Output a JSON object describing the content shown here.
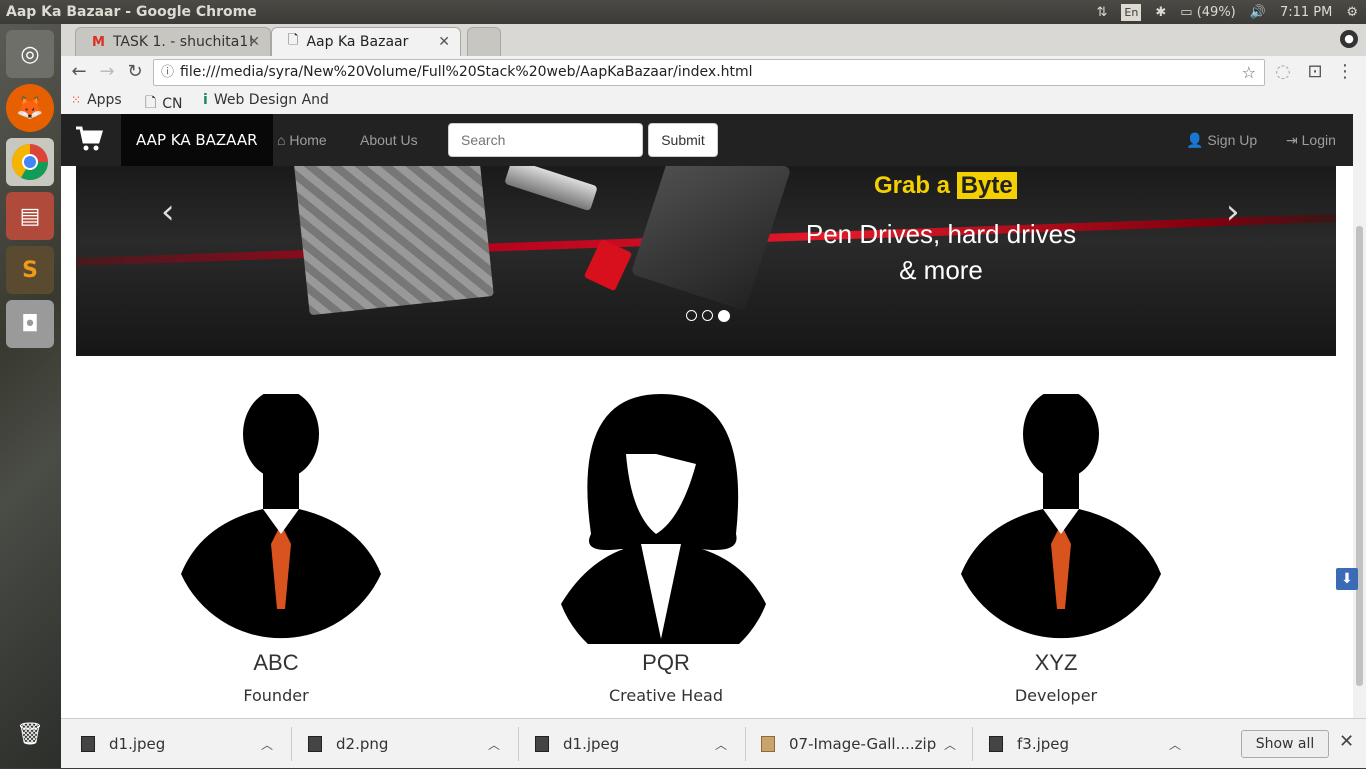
{
  "os": {
    "window_title": "Aap Ka Bazaar - Google Chrome",
    "keyboard": "En",
    "battery": "(49%)",
    "time": "7:11 PM"
  },
  "browser": {
    "tabs": [
      {
        "label": "TASK 1. - shuchita1!"
      },
      {
        "label": "Aap Ka Bazaar"
      }
    ],
    "url": "file:///media/syra/New%20Volume/Full%20Stack%20web/AapKaBazaar/index.html",
    "bookmarks": [
      {
        "label": "Apps"
      },
      {
        "label": "CN"
      },
      {
        "label": "Web Design And"
      }
    ]
  },
  "site": {
    "brand": "AAP KA BAZAAR",
    "nav": {
      "home": "Home",
      "about": "About Us",
      "signup": "Sign Up",
      "login": "Login"
    },
    "search": {
      "placeholder": "Search",
      "submit": "Submit"
    },
    "carousel": {
      "grab": "Grab a",
      "byte": "Byte",
      "line1": "Pen Drives, hard drives",
      "line2": "& more",
      "active_slide": 3,
      "slide_count": 3
    },
    "team": [
      {
        "name": "ABC",
        "role": "Founder"
      },
      {
        "name": "PQR",
        "role": "Creative Head"
      },
      {
        "name": "XYZ",
        "role": "Developer"
      }
    ]
  },
  "downloads": {
    "items": [
      {
        "name": "d1.jpeg"
      },
      {
        "name": "d2.png"
      },
      {
        "name": "d1.jpeg"
      },
      {
        "name": "07-Image-Gall....zip"
      },
      {
        "name": "f3.jpeg"
      }
    ],
    "show_all": "Show all"
  }
}
